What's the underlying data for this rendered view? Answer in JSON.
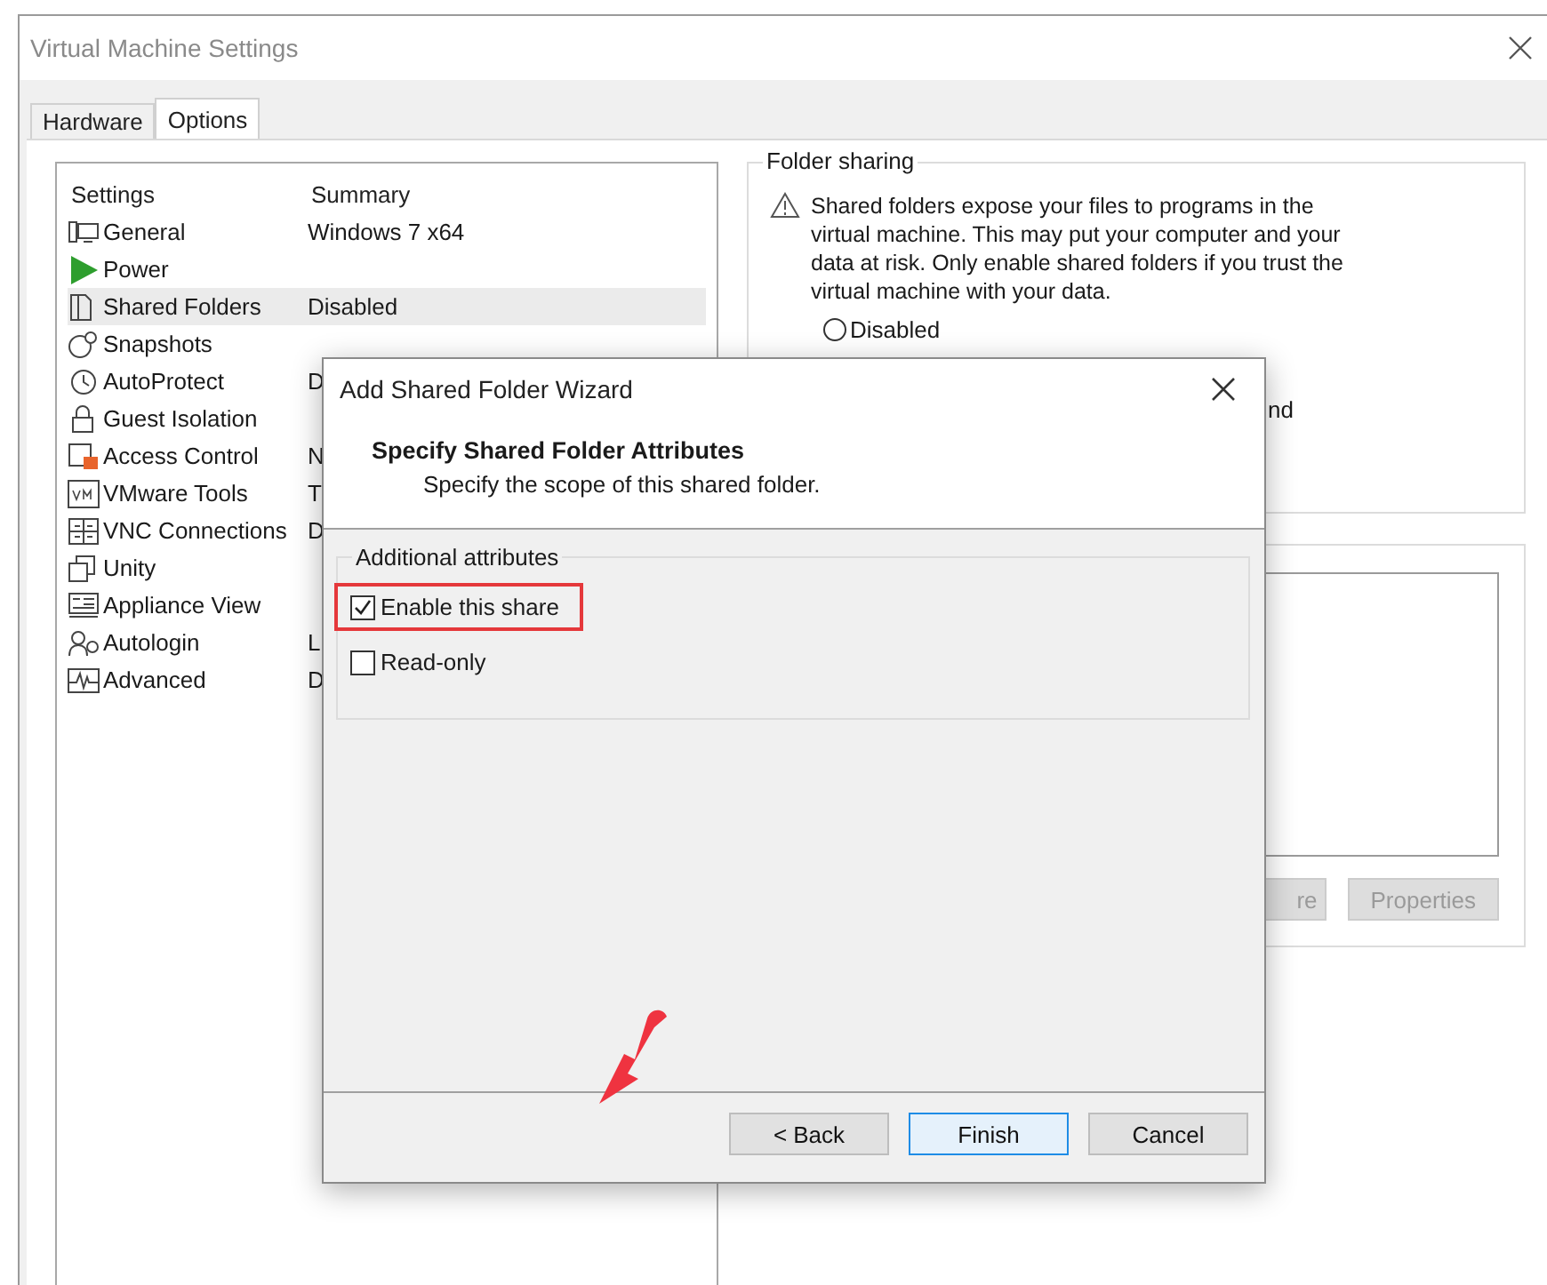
{
  "window": {
    "title": "Virtual Machine Settings"
  },
  "tabs": [
    {
      "label": "Hardware",
      "selected": false
    },
    {
      "label": "Options",
      "selected": true
    }
  ],
  "settings_list": {
    "columns": [
      "Settings",
      "Summary"
    ],
    "items": [
      {
        "name": "General",
        "summary": "Windows 7 x64",
        "selected": false
      },
      {
        "name": "Power",
        "selected": false
      },
      {
        "name": "Shared Folders",
        "summary": "Disabled",
        "selected": true
      },
      {
        "name": "Snapshots",
        "selected": false
      },
      {
        "name": "AutoProtect",
        "summary": "D",
        "selected": false
      },
      {
        "name": "Guest Isolation",
        "selected": false
      },
      {
        "name": "Access Control",
        "summary": "N",
        "selected": false
      },
      {
        "name": "VMware Tools",
        "summary": "T",
        "selected": false
      },
      {
        "name": "VNC Connections",
        "summary": "D",
        "selected": false
      },
      {
        "name": "Unity",
        "selected": false
      },
      {
        "name": "Appliance View",
        "selected": false
      },
      {
        "name": "Autologin",
        "summary": "L",
        "selected": false
      },
      {
        "name": "Advanced",
        "summary": "D",
        "selected": false
      }
    ]
  },
  "folder_sharing": {
    "title": "Folder sharing",
    "warning": "Shared folders expose your files to programs in the virtual machine. This may put your computer and your data at risk. Only enable shared folders if you trust the virtual machine with your data.",
    "options": [
      {
        "label": "Disabled",
        "selected": false
      }
    ],
    "partial_label": "nd"
  },
  "folders": {
    "buttons": [
      {
        "label": "re",
        "disabled": true
      },
      {
        "label": "Properties",
        "disabled": true
      }
    ]
  },
  "dialog": {
    "title": "Add Shared Folder Wizard",
    "heading": "Specify Shared Folder Attributes",
    "subheading": "Specify the scope of this shared folder.",
    "group_title": "Additional attributes",
    "options": [
      {
        "label": "Enable this share",
        "checked": true,
        "highlighted": true
      },
      {
        "label": "Read-only",
        "checked": false,
        "highlighted": false
      }
    ],
    "buttons": [
      {
        "label": "< Back",
        "default": false
      },
      {
        "label": "Finish",
        "default": true
      },
      {
        "label": "Cancel",
        "default": false
      }
    ]
  }
}
